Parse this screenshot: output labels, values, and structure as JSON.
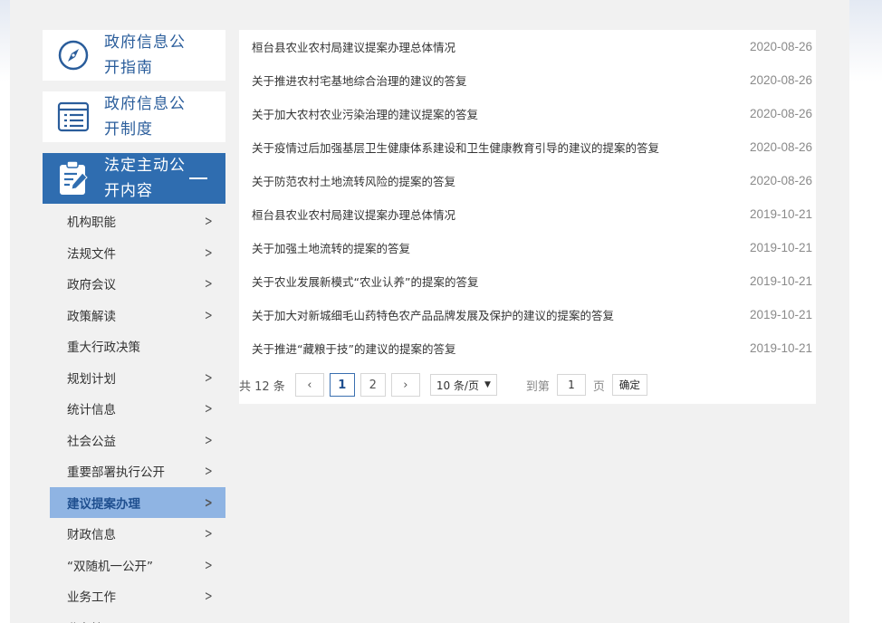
{
  "sidebar": {
    "categories": [
      {
        "label": "政府信息公开指南",
        "icon": "compass-icon"
      },
      {
        "label": "政府信息公开制度",
        "icon": "list-icon"
      },
      {
        "label": "法定主动公开内容",
        "icon": "clipboard-edit-icon"
      }
    ],
    "items": [
      {
        "label": "机构职能",
        "arrow": true
      },
      {
        "label": "法规文件",
        "arrow": true
      },
      {
        "label": "政府会议",
        "arrow": true
      },
      {
        "label": "政策解读",
        "arrow": true
      },
      {
        "label": "重大行政决策",
        "arrow": false
      },
      {
        "label": "规划计划",
        "arrow": true
      },
      {
        "label": "统计信息",
        "arrow": true
      },
      {
        "label": "社会公益",
        "arrow": true
      },
      {
        "label": "重要部署执行公开",
        "arrow": true
      },
      {
        "label": "建议提案办理",
        "arrow": true
      },
      {
        "label": "财政信息",
        "arrow": true
      },
      {
        "label": "“双随机一公开”",
        "arrow": true
      },
      {
        "label": "业务工作",
        "arrow": true
      },
      {
        "label": "业务管理",
        "arrow": true
      }
    ],
    "active_index": 9
  },
  "articles": [
    {
      "title": "桓台县农业农村局建议提案办理总体情况",
      "date": "2020-08-26"
    },
    {
      "title": "关于推进农村宅基地综合治理的建议的答复",
      "date": "2020-08-26"
    },
    {
      "title": "关于加大农村农业污染治理的建议提案的答复",
      "date": "2020-08-26"
    },
    {
      "title": "关于疫情过后加强基层卫生健康体系建设和卫生健康教育引导的建议的提案的答复",
      "date": "2020-08-26"
    },
    {
      "title": "关于防范农村土地流转风险的提案的答复",
      "date": "2020-08-26"
    },
    {
      "title": "桓台县农业农村局建议提案办理总体情况",
      "date": "2019-10-21"
    },
    {
      "title": "关于加强土地流转的提案的答复",
      "date": "2019-10-21"
    },
    {
      "title": "关于农业发展新模式“农业认养”的提案的答复",
      "date": "2019-10-21"
    },
    {
      "title": "关于加大对新城细毛山药特色农产品品牌发展及保护的建议的提案的答复",
      "date": "2019-10-21"
    },
    {
      "title": "关于推进“藏粮于技”的建议的提案的答复",
      "date": "2019-10-21"
    }
  ],
  "pager": {
    "total": "共 12 条",
    "prev": "‹",
    "pages": [
      "1",
      "2"
    ],
    "current": "1",
    "next": "›",
    "page_size": "10 条/页",
    "goto_prefix": "到第",
    "goto_value": "1",
    "goto_suffix": "页",
    "confirm": "确定"
  },
  "colors": {
    "accent": "#2f6db0",
    "active_item": "#8fb4e3",
    "category_text": "#2a5d9b"
  }
}
